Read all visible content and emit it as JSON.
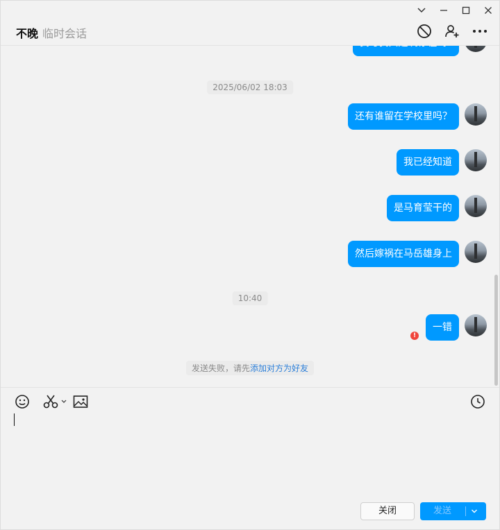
{
  "header": {
    "title": "不晚",
    "subtitle": "临时会话",
    "icons": [
      "block-icon",
      "add-friend-icon",
      "more-icon"
    ]
  },
  "window_controls": [
    "dropdown-icon",
    "minimize-icon",
    "maximize-icon",
    "close-icon"
  ],
  "chat": {
    "partial_top_message": "我与我共建筑存在吗?",
    "time_chips": [
      "2025/06/02 18:03",
      "10:40"
    ],
    "messages": [
      {
        "text": "还有谁留在学校里吗？",
        "failed": false
      },
      {
        "text": "我已经知道",
        "failed": false
      },
      {
        "text": "是马育莹干的",
        "failed": false
      },
      {
        "text": "然后嫁祸在马岳雄身上",
        "failed": false
      },
      {
        "text": "一错",
        "failed": true
      }
    ],
    "system_notice": {
      "prefix": "发送失败，请先",
      "link": "添加对方为好友"
    }
  },
  "composer": {
    "tools": [
      "emoji-icon",
      "scissors-icon",
      "image-icon",
      "history-icon"
    ],
    "close_label": "关闭",
    "send_label": "发送"
  },
  "colors": {
    "accent": "#0099ff",
    "bubble_text": "#ffffff",
    "fail": "#f0443b",
    "link": "#2c7fd9"
  }
}
